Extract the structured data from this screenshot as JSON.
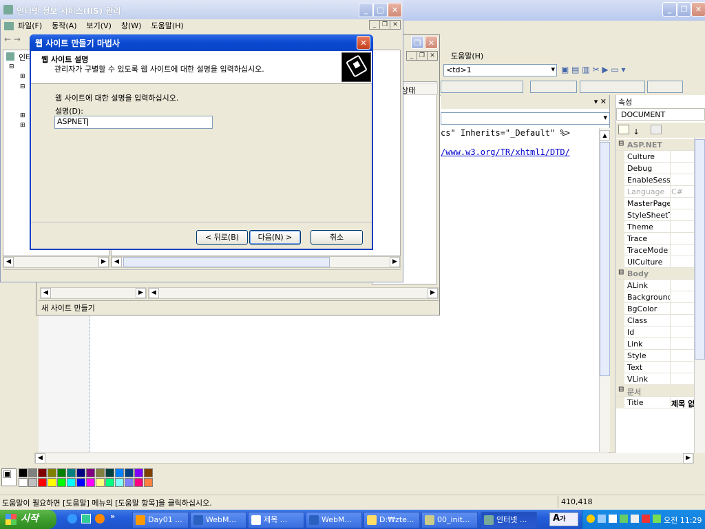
{
  "vs": {
    "menu_help": "도움말(H)",
    "combo_value": "<td>1",
    "code_line1": "cs\" Inherits=\"_Default\" %>",
    "code_line2": "/www.w3.org/TR/xhtml1/DTD/",
    "pane_close": "▾ ✕"
  },
  "properties": {
    "title": "속성",
    "object": "DOCUMENT",
    "rows": [
      {
        "k": "ASP.NET",
        "v": "",
        "cat": true
      },
      {
        "k": "Culture",
        "v": ""
      },
      {
        "k": "Debug",
        "v": ""
      },
      {
        "k": "EnableSessio",
        "v": ""
      },
      {
        "k": "Language",
        "v": "C#",
        "dim": true
      },
      {
        "k": "MasterPageF",
        "v": ""
      },
      {
        "k": "StyleSheetTh",
        "v": ""
      },
      {
        "k": "Theme",
        "v": ""
      },
      {
        "k": "Trace",
        "v": ""
      },
      {
        "k": "TraceMode",
        "v": ""
      },
      {
        "k": "UICulture",
        "v": ""
      },
      {
        "k": "Body",
        "v": "",
        "cat": true
      },
      {
        "k": "ALink",
        "v": ""
      },
      {
        "k": "Background",
        "v": ""
      },
      {
        "k": "BgColor",
        "v": ""
      },
      {
        "k": "Class",
        "v": ""
      },
      {
        "k": "Id",
        "v": ""
      },
      {
        "k": "Link",
        "v": ""
      },
      {
        "k": "Style",
        "v": ""
      },
      {
        "k": "Text",
        "v": ""
      },
      {
        "k": "VLink",
        "v": ""
      },
      {
        "k": "문서",
        "v": "",
        "cat": true
      },
      {
        "k": "Title",
        "v": "제목 없"
      }
    ]
  },
  "iis": {
    "title": "인터넷 정보 서비스(IIS) 관리",
    "menu": [
      "파일(F)",
      "동작(A)",
      "보기(V)",
      "창(W)",
      "도움말(H)"
    ],
    "tree_label": "인터",
    "inner_status": "새 사이트 만들기",
    "column_status": "상태"
  },
  "wizard": {
    "title": "웹 사이트 만들기 마법사",
    "header_title": "웹 사이트 설명",
    "header_sub": "관리자가 구별할 수 있도록 웹 사이트에 대한 설명을 입력하십시오.",
    "prompt": "웹 사이트에 대한 설명을 입력하십시오.",
    "field_label": "설명(D):",
    "field_value": "ASPNET",
    "back_btn": "< 뒤로(B)",
    "next_btn": "다음(N) >",
    "cancel_btn": "취소"
  },
  "statusbar": {
    "help_text": "도움말이 필요하면 [도움말] 메뉴의 [도움말 항목]을 클릭하십시오.",
    "coords": "410,418"
  },
  "palette": {
    "row1": [
      "#000000",
      "#808080",
      "#800000",
      "#808000",
      "#008000",
      "#008080",
      "#000080",
      "#800080",
      "#808040",
      "#004040",
      "#0080ff",
      "#004080",
      "#8000ff",
      "#804000"
    ],
    "row2": [
      "#ffffff",
      "#c0c0c0",
      "#ff0000",
      "#ffff00",
      "#00ff00",
      "#00ffff",
      "#0000ff",
      "#ff00ff",
      "#ffff80",
      "#00ff80",
      "#80ffff",
      "#8080ff",
      "#ff0080",
      "#ff8040"
    ]
  },
  "taskbar": {
    "start": "시작",
    "tasks": [
      "Day01 ...",
      "WebM...",
      "제목 ...",
      "WebM...",
      "D:₩zte...",
      "00_init...",
      "인터넷 ..."
    ],
    "clock": "오전 11:29"
  }
}
